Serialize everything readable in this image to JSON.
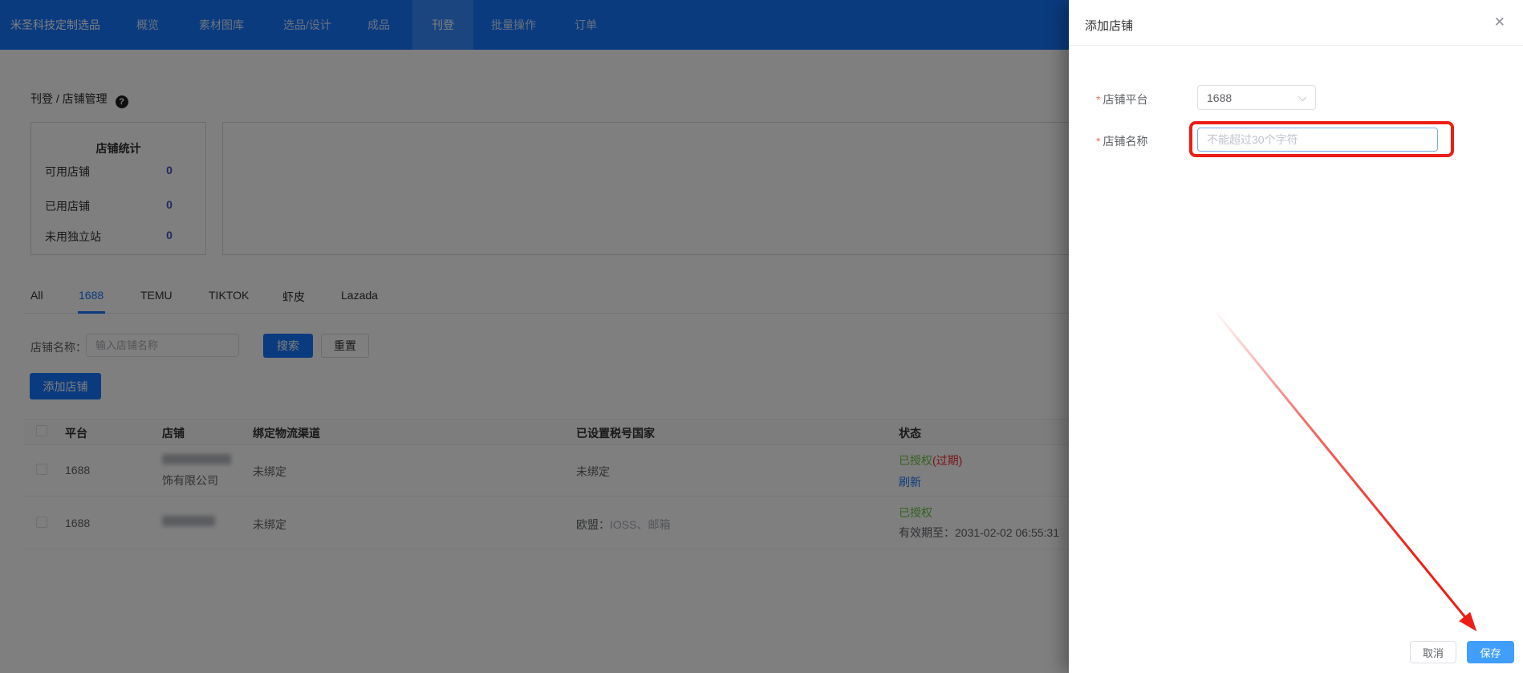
{
  "nav": {
    "brand": "米圣科技定制选品",
    "items": [
      "概览",
      "素材图库",
      "选品/设计",
      "成品",
      "刊登",
      "批量操作",
      "订单"
    ],
    "active": "刊登"
  },
  "breadcrumb": {
    "section": "刊登",
    "separator": "/",
    "page": "店铺管理",
    "help_icon": "?"
  },
  "stats": {
    "title": "店铺统计",
    "rows": [
      {
        "label": "可用店铺",
        "value": "0"
      },
      {
        "label": "已用店铺",
        "value": "0"
      },
      {
        "label": "未用独立站",
        "value": "0"
      }
    ]
  },
  "tabs": {
    "items": [
      "All",
      "1688",
      "TEMU",
      "TIKTOK",
      "虾皮",
      "Lazada"
    ],
    "active": "1688"
  },
  "filter": {
    "label": "店铺名称：",
    "placeholder": "输入店铺名称",
    "search_button": "搜索",
    "reset_button": "重置"
  },
  "add_store_button": "添加店铺",
  "table": {
    "headers": [
      "平台",
      "店铺",
      "绑定物流渠道",
      "已设置税号国家",
      "状态"
    ],
    "rows": [
      {
        "platform": "1688",
        "store_name_line2": "饰有限公司",
        "logistics": "未绑定",
        "tax_countries": "未绑定",
        "status": "已授权",
        "status_suffix": "(过期)",
        "action": "刷新"
      },
      {
        "platform": "1688",
        "logistics": "未绑定",
        "tax_prefix": "欧盟：",
        "tax_value": "IOSS、邮箱",
        "status": "已授权",
        "validity": "有效期至：2031-02-02 06:55:31"
      }
    ]
  },
  "drawer": {
    "title": "添加店铺",
    "close_icon": "✕",
    "form": {
      "required_mark": "*",
      "platform_label": "店铺平台",
      "platform_value": "1688",
      "name_label": "店铺名称",
      "name_placeholder": "不能超过30个字符"
    },
    "footer": {
      "cancel": "取消",
      "save": "保存"
    }
  },
  "colors": {
    "nav_background": "#1677ff",
    "primary_blue": "#1677ff",
    "save_button_blue": "#409eff",
    "stat_value_blue": "#4150c0",
    "status_green": "#67c23a",
    "status_red": "#f5222d",
    "annotation_red": "#ed1e15"
  }
}
